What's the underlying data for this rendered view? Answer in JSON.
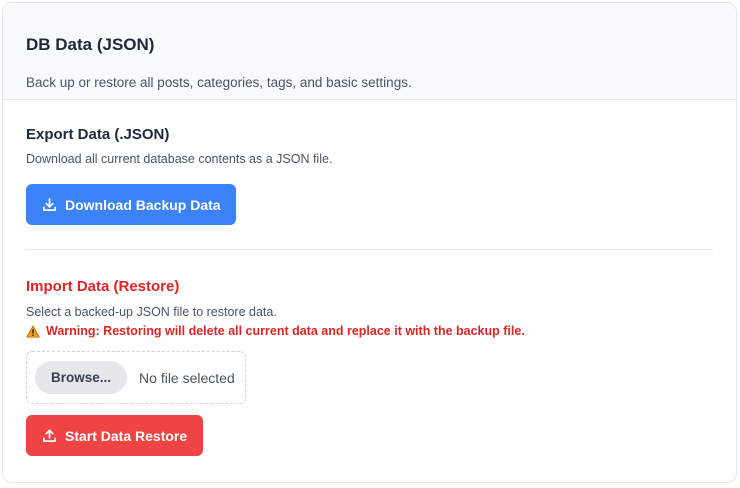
{
  "header": {
    "title": "DB Data (JSON)",
    "subtitle": "Back up or restore all posts, categories, tags, and basic settings."
  },
  "export": {
    "title": "Export Data (.JSON)",
    "description": "Download all current database contents as a JSON file.",
    "button_label": "Download Backup Data",
    "button_icon": "download-icon",
    "button_color": "#3b82f6"
  },
  "import": {
    "title": "Import Data (Restore)",
    "title_color": "#dc2626",
    "description": "Select a backed-up JSON file to restore data.",
    "warning_icon": "warning-icon",
    "warning": "Warning: Restoring will delete all current data and replace it with the backup file.",
    "browse_label": "Browse...",
    "file_status": "No file selected",
    "button_label": "Start Data Restore",
    "button_icon": "upload-icon",
    "button_color": "#ef4444"
  }
}
